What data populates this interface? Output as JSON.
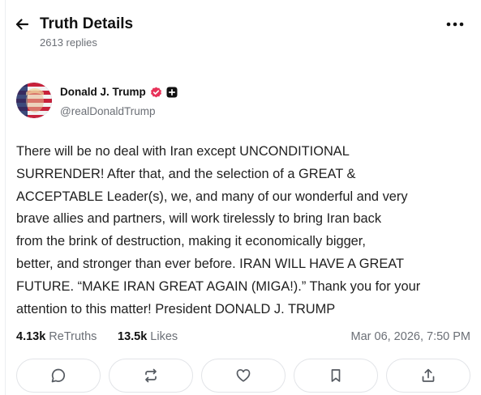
{
  "header": {
    "title": "Truth Details",
    "replies": "2613 replies"
  },
  "author": {
    "name": "Donald J. Trump",
    "handle": "@realDonaldTrump"
  },
  "post": {
    "text": "There will be no deal with Iran except UNCONDITIONAL\nSURRENDER! After that, and the selection of a GREAT &\nACCEPTABLE Leader(s), we, and many of our wonderful and very\nbrave allies and partners, will work tirelessly to bring Iran back\nfrom the brink of destruction, making it economically bigger,\nbetter, and stronger than ever before. IRAN WILL HAVE A GREAT\nFUTURE. “MAKE IRAN GREAT AGAIN (MIGA!).” Thank you for your\nattention to this matter! President DONALD J. TRUMP"
  },
  "stats": {
    "retruths_count": "4.13k",
    "retruths_label": "ReTruths",
    "likes_count": "13.5k",
    "likes_label": "Likes",
    "timestamp": "Mar 06, 2026, 7:50 PM"
  },
  "actions": [
    "reply",
    "retruth",
    "like",
    "bookmark",
    "share"
  ],
  "colors": {
    "verified": "#e8335a",
    "muted": "#6b6f76",
    "border": "#e2e4e8"
  }
}
